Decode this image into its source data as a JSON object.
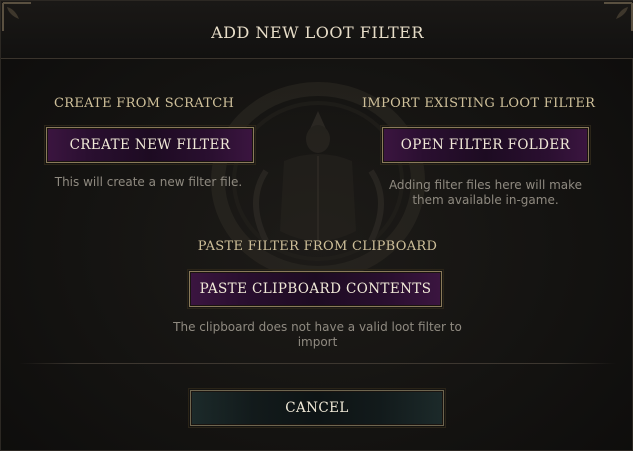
{
  "dialog": {
    "title": "ADD NEW LOOT FILTER"
  },
  "scratch": {
    "label": "CREATE FROM SCRATCH",
    "button": "CREATE NEW FILTER",
    "description": "This will create a new filter file."
  },
  "import": {
    "label": "IMPORT EXISTING LOOT FILTER",
    "button": "OPEN FILTER FOLDER",
    "description_line1": "Adding filter files here will make",
    "description_line2": "them available in-game."
  },
  "clipboard": {
    "label": "PASTE FILTER FROM CLIPBOARD",
    "button": "PASTE CLIPBOARD CONTENTS",
    "description_line1": "The clipboard does not have a valid loot filter to",
    "description_line2": "import"
  },
  "footer": {
    "cancel": "CANCEL"
  },
  "colors": {
    "accent_purple": "#3b1540",
    "gold_text": "#cfc09a",
    "body_text": "#8f8a80"
  }
}
